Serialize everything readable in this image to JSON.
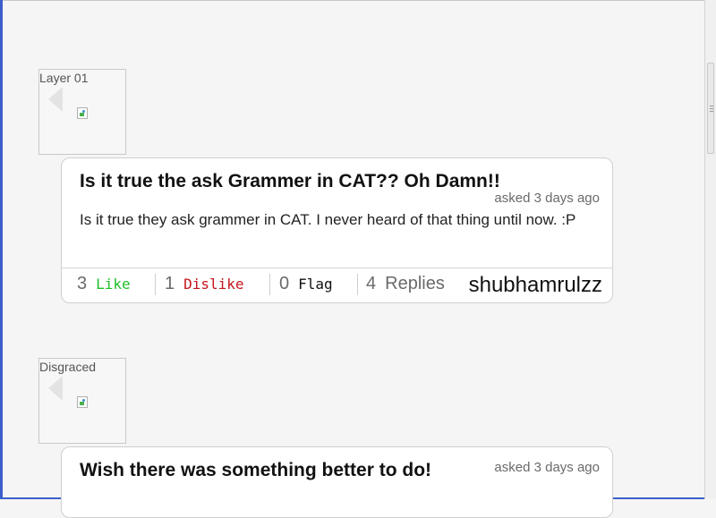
{
  "posts": [
    {
      "avatar_label": "Layer 01",
      "title": "Is it true the ask Grammer in CAT?? Oh Damn!!",
      "asked": "asked 3 days ago",
      "body": "Is it true they ask grammer in CAT. I never heard of that thing until now. :P",
      "likes": "3",
      "like_label": "Like",
      "dislikes": "1",
      "dislike_label": "Dislike",
      "flags": "0",
      "flag_label": "Flag",
      "replies": "4",
      "replies_label": "Replies",
      "author": "shubhamrulzz"
    },
    {
      "avatar_label": "Disgraced",
      "title": "Wish there was something better to do!",
      "asked": "asked 3 days ago"
    }
  ],
  "colors": {
    "like": "#1fbf2a",
    "dislike": "#c4161c",
    "flag": "#111111",
    "accent_border": "#3a5fcd"
  },
  "icons": {
    "avatar_placeholder": "broken-image-icon",
    "avatar_arrow": "chevron-left-icon"
  }
}
